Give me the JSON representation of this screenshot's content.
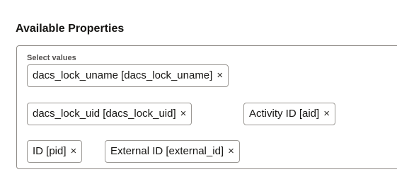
{
  "section": {
    "title": "Available Properties"
  },
  "select": {
    "label": "Select values",
    "chips": [
      {
        "label": "dacs_lock_uname [dacs_lock_uname]",
        "remove": "×"
      },
      {
        "label": "dacs_lock_uid [dacs_lock_uid]",
        "remove": "×"
      },
      {
        "label": "Activity ID [aid]",
        "remove": "×"
      },
      {
        "label": "ID [pid]",
        "remove": "×"
      },
      {
        "label": "External ID [external_id]",
        "remove": "×"
      }
    ]
  }
}
